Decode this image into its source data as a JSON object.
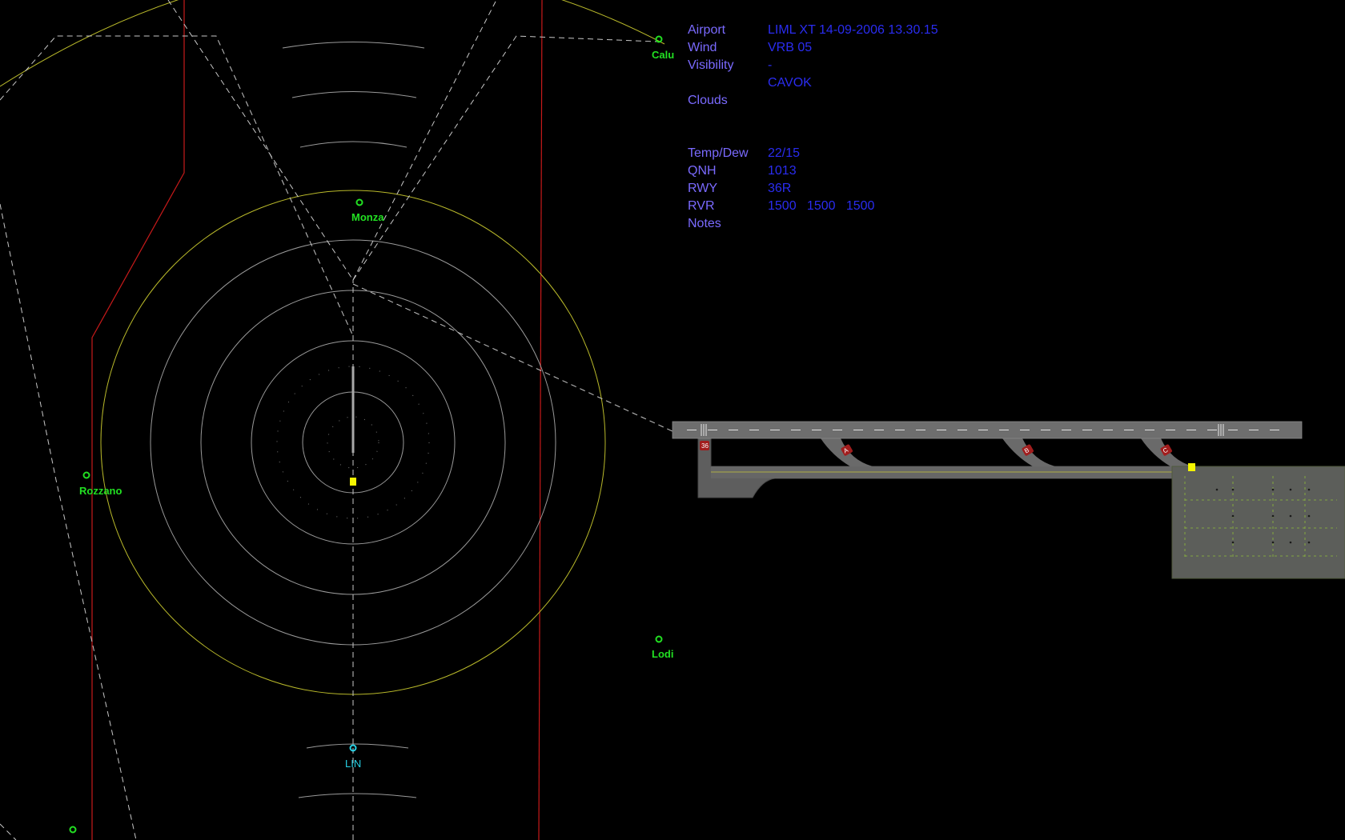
{
  "app": {
    "metar_panel": {
      "airport_label": "Airport",
      "airport_value": "LIML XT 14-09-2006 13.30.15",
      "wind_label": "Wind",
      "wind_value": "VRB 05",
      "visibility_label": "Visibility",
      "visibility_value": "-",
      "sky_value": "CAVOK",
      "clouds_label": "Clouds",
      "tempdew_label": "Temp/Dew",
      "tempdew_value": "22/15",
      "qnh_label": "QNH",
      "qnh_value": "1013",
      "rwy_label": "RWY",
      "rwy_value": "36R",
      "rvr_label": "RVR",
      "rvr_value": "1500   1500   1500",
      "notes_label": "Notes"
    },
    "radar": {
      "fixes": [
        {
          "id": "monza",
          "label": "Monza"
        },
        {
          "id": "rozzano",
          "label": "Rozzano"
        },
        {
          "id": "calu",
          "label": "Calu"
        },
        {
          "id": "lodi",
          "label": "Lodi"
        },
        {
          "id": "lin",
          "label": "LIN"
        }
      ]
    },
    "ground_view": {
      "taxiway_signs": [
        "36",
        "A",
        "B",
        "C"
      ]
    },
    "colors": {
      "background": "#000000",
      "fix_green": "#22e022",
      "vor_cyan": "#27d2e6",
      "airspace_red": "#c81a1a",
      "range_yellow": "#b9b92a",
      "metar_label": "#7a6aff",
      "metar_value": "#2a2cf0",
      "aircraft_yellow": "#f5f500",
      "asphalt": "#6e6e6e"
    }
  }
}
